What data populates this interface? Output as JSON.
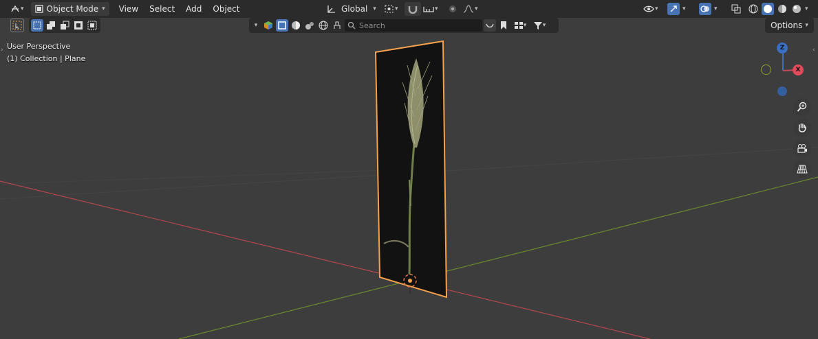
{
  "header": {
    "mode_label": "Object Mode",
    "menus": [
      "View",
      "Select",
      "Add",
      "Object"
    ],
    "transform_orientation": "Global"
  },
  "toolbar": {
    "search_placeholder": "Search",
    "options_label": "Options"
  },
  "viewport": {
    "perspective_label": "User Perspective",
    "collection_label": "(1) Collection | Plane"
  },
  "gizmo": {
    "z_label": "Z",
    "x_label": "X"
  },
  "colors": {
    "accent": "#4772b3",
    "selection_outline": "#f5a04a",
    "x_axis": "#b4474e",
    "y_axis": "#6a8a2e",
    "z_axis": "#3a6fc4"
  }
}
